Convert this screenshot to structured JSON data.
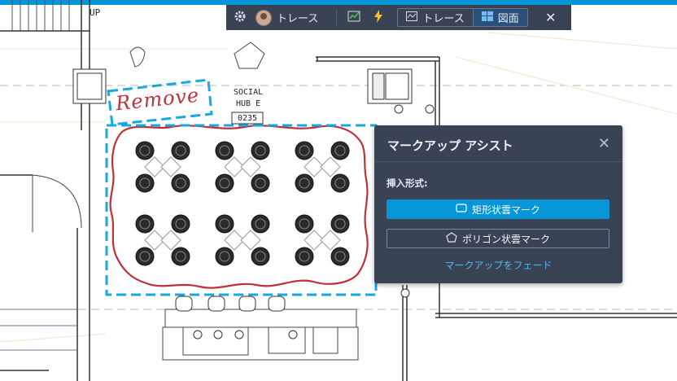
{
  "toolbar": {
    "settings_icon": "gear-icon",
    "user_label": "トレース",
    "markup_icon": "markup-check-icon",
    "lightning_icon": "lightning-icon",
    "trace_tab_label": "トレース",
    "drawing_tab_label": "図面",
    "close_icon": "close-icon"
  },
  "drawing": {
    "up_label": "UP",
    "room_name_line1": "SOCIAL",
    "room_name_line2": "HUB E",
    "room_number": "0235",
    "handwriting": "Remove"
  },
  "panel": {
    "title": "マークアップ アシスト",
    "insert_label": "挿入形式:",
    "rect_button": "矩形状雲マーク",
    "polygon_button": "ポリゴン状雲マーク",
    "fade_link": "マークアップをフェード"
  },
  "colors": {
    "accent": "#0696d7",
    "toolbar_bg": "#3a4354",
    "cloud_red": "#c0303a",
    "selection_blue": "#19a7e0"
  }
}
